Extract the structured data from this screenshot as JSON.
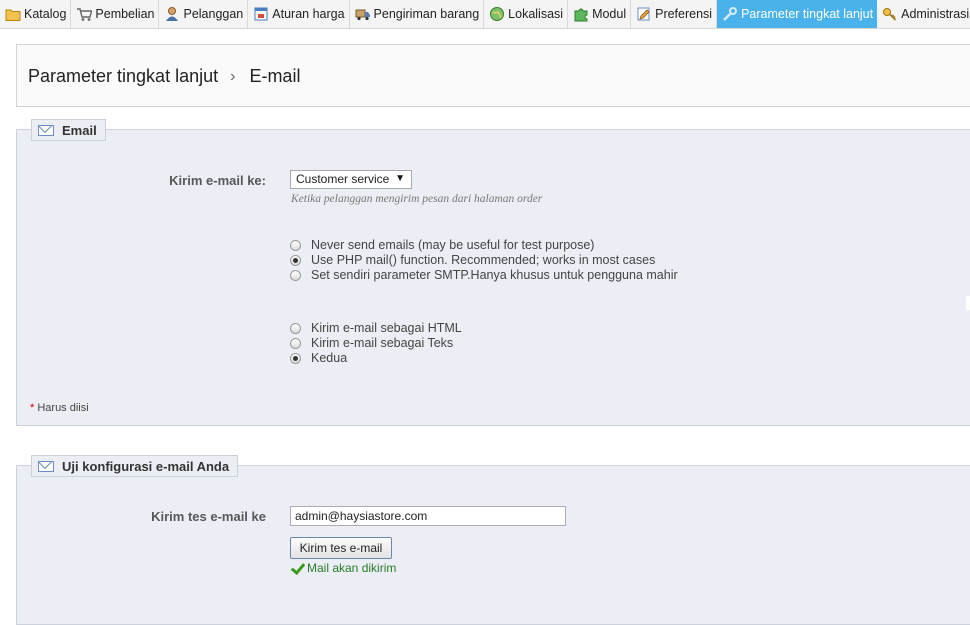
{
  "nav": {
    "tabs": [
      {
        "label": "Katalog",
        "icon": "folder-icon",
        "active": false
      },
      {
        "label": "Pembelian",
        "icon": "cart-icon",
        "active": false
      },
      {
        "label": "Pelanggan",
        "icon": "user-icon",
        "active": false
      },
      {
        "label": "Aturan harga",
        "icon": "price-rules-icon",
        "active": false
      },
      {
        "label": "Pengiriman barang",
        "icon": "truck-icon",
        "active": false
      },
      {
        "label": "Lokalisasi",
        "icon": "globe-icon",
        "active": false
      },
      {
        "label": "Modul",
        "icon": "puzzle-icon",
        "active": false
      },
      {
        "label": "Preferensi",
        "icon": "preferences-icon",
        "active": false
      },
      {
        "label": "Parameter tingkat lanjut",
        "icon": "wrench-icon",
        "active": true
      },
      {
        "label": "Administrasi",
        "icon": "key-icon",
        "active": false
      }
    ],
    "active_color": "#49b2ea"
  },
  "breadcrumb": {
    "parent": "Parameter tingkat lanjut",
    "separator": "›",
    "current": "E-mail"
  },
  "email_section": {
    "legend": "Email",
    "send_to_label": "Kirim e-mail ke:",
    "send_to_value": "Customer service",
    "send_to_hint": "Ketika pelanggan mengirim pesan dari halaman order",
    "method_options": [
      {
        "label": "Never send emails (may be useful for test purpose)",
        "checked": false
      },
      {
        "label": "Use PHP mail() function. Recommended; works in most cases",
        "checked": true
      },
      {
        "label": "Set sendiri parameter SMTP.Hanya khusus untuk pengguna mahir",
        "checked": false
      }
    ],
    "format_options": [
      {
        "label": "Kirim e-mail sebagai HTML",
        "checked": false
      },
      {
        "label": "Kirim e-mail sebagai Teks",
        "checked": false
      },
      {
        "label": "Kedua",
        "checked": true
      }
    ],
    "required_star": "*",
    "required_note": "Harus diisi"
  },
  "test_section": {
    "legend": "Uji konfigurasi e-mail Anda",
    "label": "Kirim tes e-mail ke",
    "email_value": "admin@haysiastore.com",
    "button_label": "Kirim tes e-mail",
    "status": "Mail akan dikirim",
    "status_color": "#2a7a2a"
  }
}
